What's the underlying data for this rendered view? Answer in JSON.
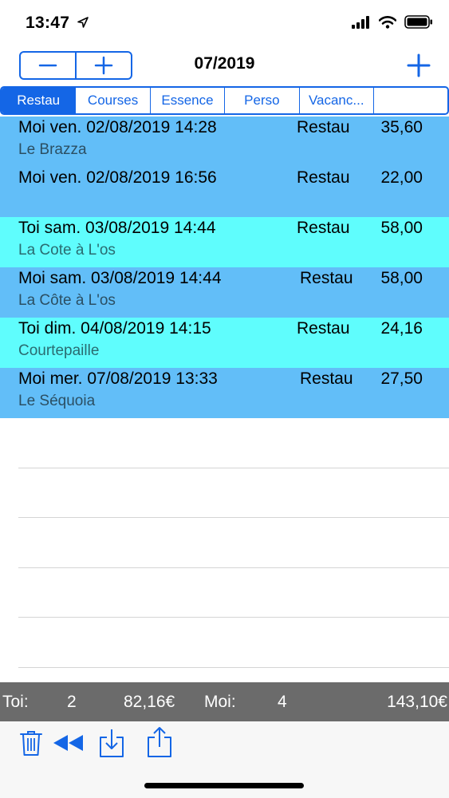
{
  "status_bar": {
    "time": "13:47",
    "icons": [
      "location-arrow-icon",
      "signal-bars-icon",
      "wifi-icon",
      "battery-icon"
    ]
  },
  "nav": {
    "title": "07/2019",
    "stepper": {
      "decrement_icon": "minus-icon",
      "increment_icon": "plus-icon"
    },
    "add_icon": "plus-icon",
    "accent_color": "#1466e6"
  },
  "segments": [
    {
      "label": "Restau",
      "active": true
    },
    {
      "label": "Courses",
      "active": false
    },
    {
      "label": "Essence",
      "active": false
    },
    {
      "label": "Perso",
      "active": false
    },
    {
      "label": "Vacanc...",
      "active": false
    }
  ],
  "colors": {
    "moi_row": "#62bef8",
    "toi_row": "#5ffdfd",
    "totals_bar": "#6b6b6b"
  },
  "entries": [
    {
      "who": "moi",
      "date": "Moi ven. 02/08/2019 14:28",
      "category": "Restau",
      "amount": "35,60",
      "place": "Le Brazza"
    },
    {
      "who": "moi",
      "date": "Moi ven. 02/08/2019 16:56",
      "category": "Restau",
      "amount": "22,00",
      "place": ""
    },
    {
      "who": "toi",
      "date": "Toi sam. 03/08/2019 14:44",
      "category": "Restau",
      "amount": "58,00",
      "place": "La Cote à L'os"
    },
    {
      "who": "moi",
      "date": "Moi sam. 03/08/2019 14:44",
      "category": "Restau",
      "amount": "58,00",
      "place": "La Côte à L'os"
    },
    {
      "who": "toi",
      "date": "Toi dim. 04/08/2019 14:15",
      "category": "Restau",
      "amount": "24,16",
      "place": "Courtepaille"
    },
    {
      "who": "moi",
      "date": "Moi mer. 07/08/2019 13:33",
      "category": "Restau",
      "amount": "27,50",
      "place": "Le Séquoia"
    }
  ],
  "totals": {
    "toi_label": "Toi:",
    "toi_count": "2",
    "toi_amount": "82,16€",
    "moi_label": "Moi:",
    "moi_count": "4",
    "moi_amount": "143,10€"
  },
  "toolbar": {
    "icons": [
      "trash-icon",
      "rewind-icon",
      "download-icon",
      "share-icon"
    ]
  }
}
